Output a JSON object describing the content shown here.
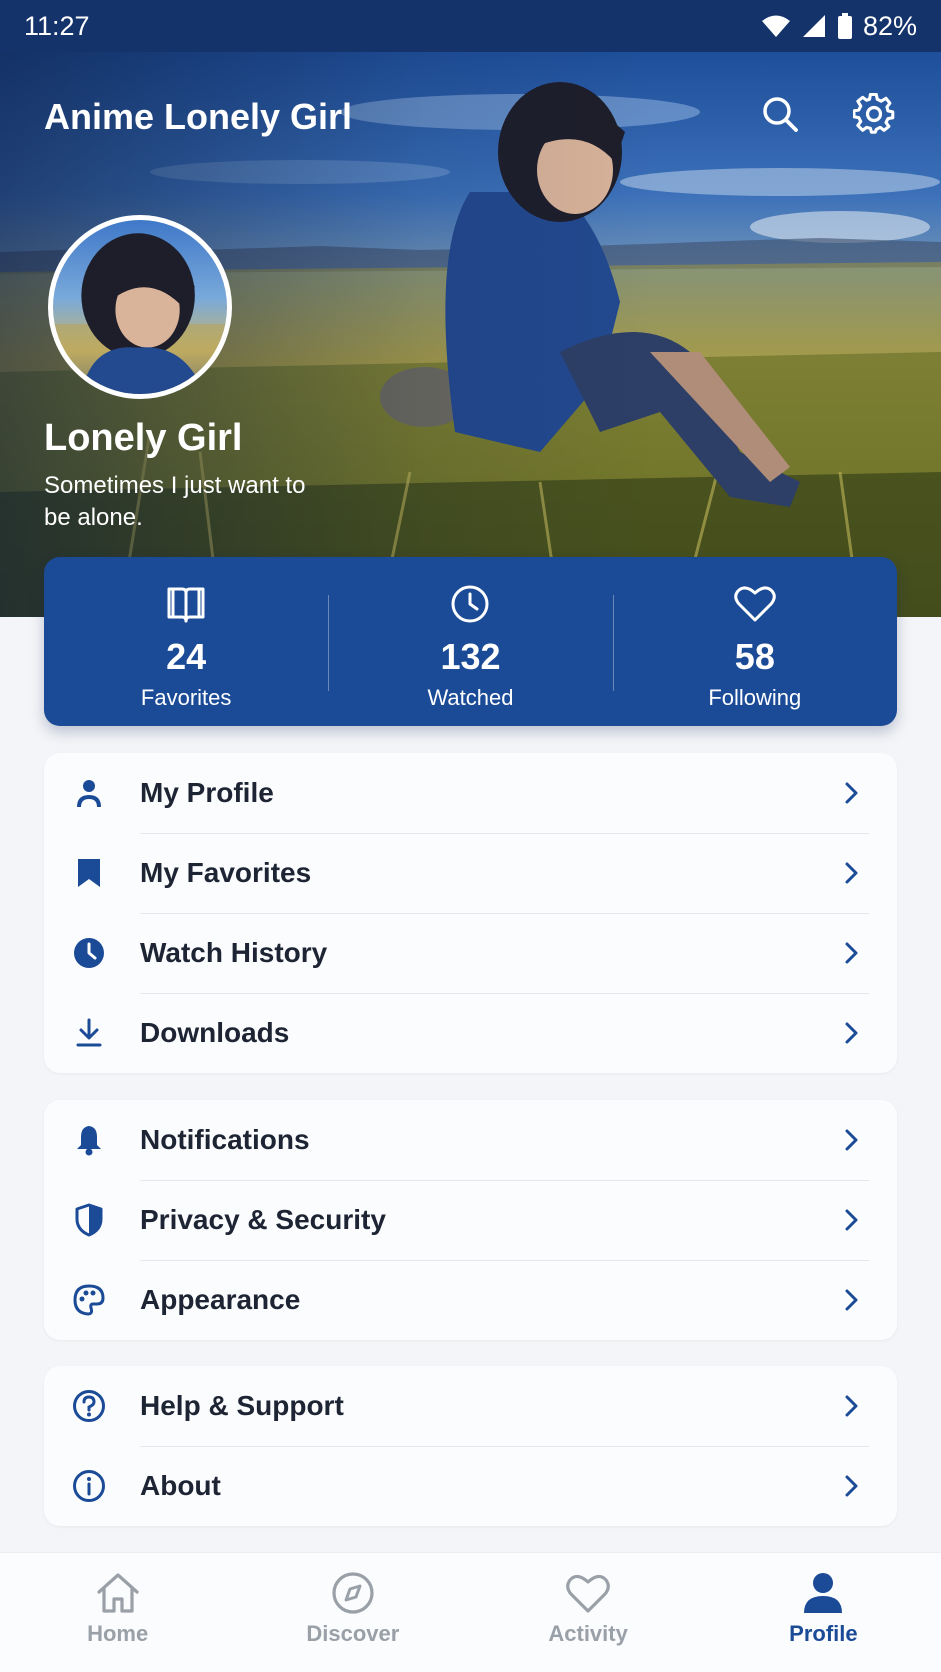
{
  "status_bar": {
    "time": "11:27",
    "battery": "82%"
  },
  "app": {
    "title": "Anime Lonely Girl"
  },
  "profile": {
    "name": "Lonely Girl",
    "bio": "Sometimes I just want to be alone."
  },
  "stats": [
    {
      "icon": "book-icon",
      "value": "24",
      "label": "Favorites"
    },
    {
      "icon": "clock-icon",
      "value": "132",
      "label": "Watched"
    },
    {
      "icon": "heart-icon",
      "value": "58",
      "label": "Following"
    }
  ],
  "menu": {
    "group1": [
      {
        "icon": "person-icon",
        "label": "My Profile"
      },
      {
        "icon": "bookmark-icon",
        "label": "My Favorites"
      },
      {
        "icon": "history-clock-icon",
        "label": "Watch History"
      },
      {
        "icon": "download-icon",
        "label": "Downloads"
      }
    ],
    "group2": [
      {
        "icon": "bell-icon",
        "label": "Notifications"
      },
      {
        "icon": "shield-icon",
        "label": "Privacy & Security"
      },
      {
        "icon": "palette-icon",
        "label": "Appearance"
      }
    ],
    "group3": [
      {
        "icon": "help-icon",
        "label": "Help & Support"
      },
      {
        "icon": "info-icon",
        "label": "About"
      }
    ]
  },
  "bottom_nav": [
    {
      "icon": "home-icon",
      "label": "Home",
      "active": false
    },
    {
      "icon": "compass-icon",
      "label": "Discover",
      "active": false
    },
    {
      "icon": "heart-outline-icon",
      "label": "Activity",
      "active": false
    },
    {
      "icon": "profile-icon",
      "label": "Profile",
      "active": true
    }
  ],
  "colors": {
    "primary": "#1b4b97",
    "status_bar": "#15336b",
    "inactive": "#9aa0a8"
  }
}
